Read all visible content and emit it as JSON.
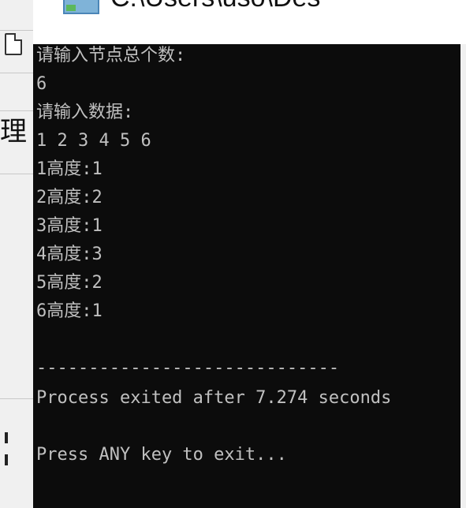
{
  "window": {
    "title": "C:\\Users\\uso\\Des"
  },
  "console": {
    "lines": [
      "请输入节点总个数:",
      "6",
      "请输入数据:",
      "1 2 3 4 5 6",
      "1高度:1",
      "2高度:2",
      "3高度:1",
      "4高度:3",
      "5高度:2",
      "6高度:1",
      "",
      "-----------------------------",
      "Process exited after 7.274 seconds",
      "",
      "Press ANY key to exit..."
    ]
  },
  "ide": {
    "glyph": "理"
  },
  "colors": {
    "console_bg": "#0c0c0c",
    "console_fg": "#c0c0c0",
    "ide_bg": "#f0f0f0"
  }
}
